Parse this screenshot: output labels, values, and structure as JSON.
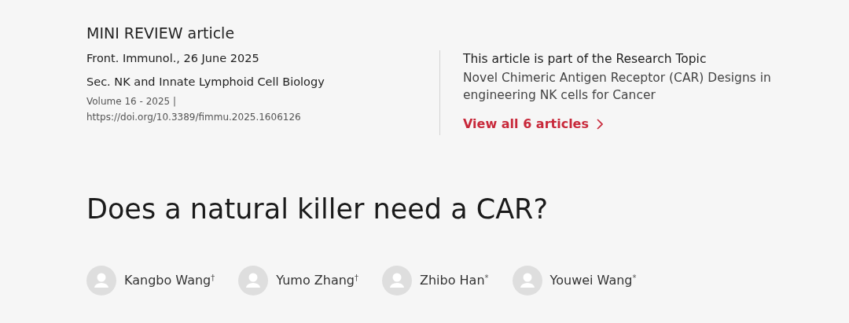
{
  "article_type": "MINI REVIEW article",
  "journal_line": "Front. Immunol., 26 June 2025",
  "section": "Sec. NK and Innate Lymphoid Cell Biology",
  "volume": "Volume 16 - 2025 |",
  "doi": "https://doi.org/10.3389/fimmu.2025.1606126",
  "research_topic": {
    "heading": "This article is part of the Research Topic",
    "title": "Novel Chimeric Antigen Receptor (CAR) Designs in engineering NK cells for Cancer",
    "link": "View all 6 articles"
  },
  "title": "Does a natural killer need a CAR?",
  "authors": [
    {
      "name": "Kangbo Wang",
      "mark": "†"
    },
    {
      "name": "Yumo Zhang",
      "mark": "†"
    },
    {
      "name": "Zhibo Han",
      "mark": "*"
    },
    {
      "name": "Youwei Wang",
      "mark": "*"
    }
  ]
}
